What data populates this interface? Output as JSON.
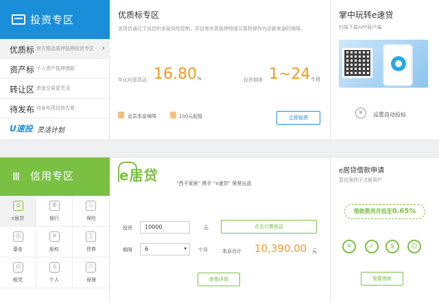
{
  "invest": {
    "title": "投资专区",
    "nav": [
      {
        "label": "优质标",
        "desc": "官方精选质押抵押投资专区",
        "arrow": "›"
      },
      {
        "label": "资产标",
        "desc": "个人资产抵押借款"
      },
      {
        "label": "转让区",
        "desc": "资金交易更灵活"
      },
      {
        "label": "待发布",
        "desc": "待发布项目抢先看"
      }
    ],
    "plan_logo": "U速投",
    "plan_label": "灵活计划"
  },
  "premium": {
    "title": "优质标专区",
    "desc": "该项目通过了风控的多层风险控制，并且有优质抵押物或可靠担保作为还款来源的保障。",
    "rate_label": "年化利率高达",
    "rate_value": "16.80",
    "rate_unit": "%",
    "term_label": "投资期限",
    "term_value": "1~24",
    "term_unit": "个月",
    "badge1": "会员本息保障",
    "badge2": "100元起投",
    "invest_button": "立即投资"
  },
  "app_promo": {
    "title": "掌中玩转e速贷",
    "subtitle": "扫描下载APP客户端",
    "auto_icon": "¥",
    "auto_label": "设置自动投标"
  },
  "credit": {
    "title": "信用专区",
    "items": [
      {
        "label": "e居贷",
        "icon": "house-icon",
        "glyph": "⌂"
      },
      {
        "label": "银行",
        "icon": "bank-icon",
        "glyph": "Ⅲ"
      },
      {
        "label": "保险",
        "icon": "shield-icon",
        "glyph": "◇"
      },
      {
        "label": "基金",
        "icon": "coin-icon",
        "glyph": "◎"
      },
      {
        "label": "股权",
        "icon": "handshake-icon",
        "glyph": "✕"
      },
      {
        "label": "债券",
        "icon": "document-icon",
        "glyph": "▯"
      },
      {
        "label": "租凭",
        "icon": "car-icon",
        "glyph": "⊙"
      },
      {
        "label": "个人",
        "icon": "person-icon",
        "glyph": "♙"
      },
      {
        "label": "保理",
        "icon": "bookmark-icon",
        "glyph": "⌑"
      }
    ]
  },
  "ejd": {
    "logo": "e居贷",
    "slogan": "“西子家居” 携手 “e速贷” 荣誉出品",
    "invest_label": "投资",
    "invest_value": "10000",
    "invest_unit": "元",
    "calc_button": "点击计算收益",
    "term_label": "期限",
    "term_value": "6",
    "term_caret": "▾",
    "term_unit": "个月",
    "total_label": "本息合计",
    "total_value": "10,390.00",
    "total_unit": "元",
    "detail_button": "查看详情"
  },
  "apply": {
    "title": "e居贷借款申请",
    "subtitle": "暂仅限西子注册用户",
    "ribbon_text": "借款费用月低至",
    "ribbon_pct": "0.65%",
    "icons": [
      {
        "name": "no-fee-icon",
        "glyph": "✕"
      },
      {
        "name": "fast-icon",
        "glyph": "✓"
      },
      {
        "name": "money-icon",
        "glyph": "$"
      },
      {
        "name": "smile-icon",
        "glyph": "☺"
      }
    ],
    "loan_button": "我要借款"
  },
  "colors": {
    "blue": "#1a8ed8",
    "green": "#7ac143",
    "orange": "#f39a1e"
  }
}
